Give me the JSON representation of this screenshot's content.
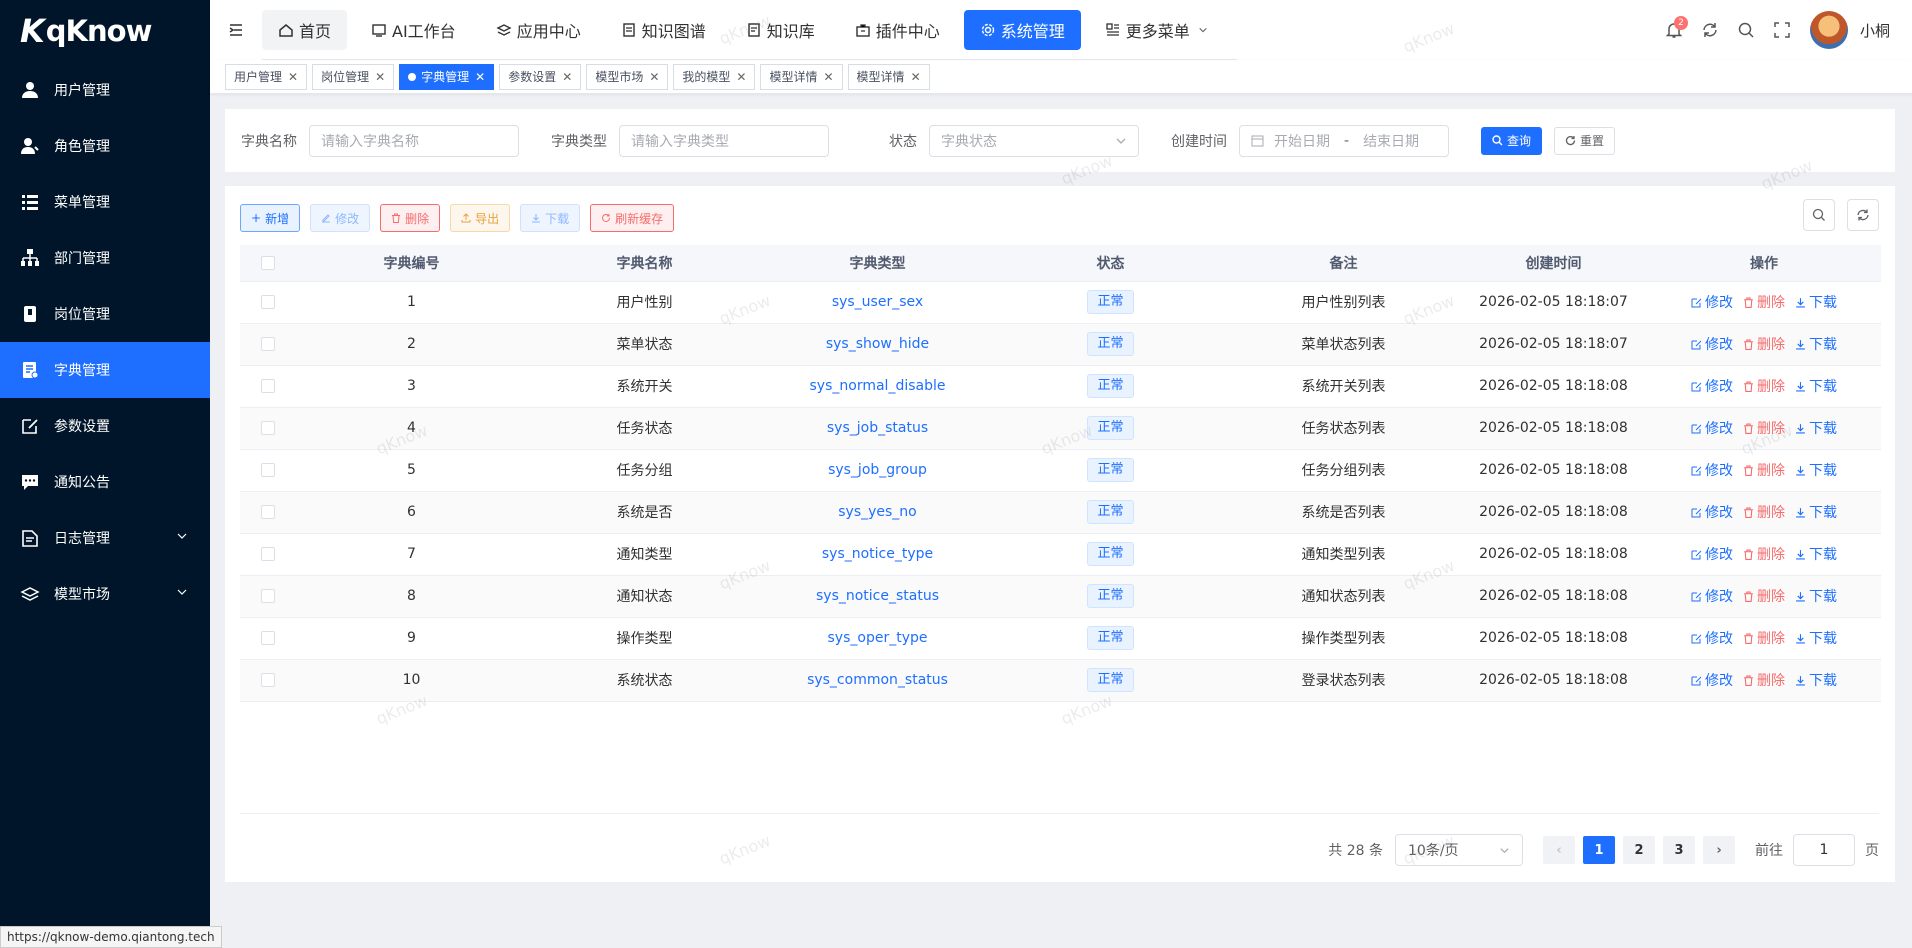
{
  "app": {
    "logo_text": "qKnow",
    "logo_mark": "K"
  },
  "sidebar": {
    "items": [
      {
        "label": "用户管理",
        "icon": "user-icon",
        "active": false
      },
      {
        "label": "角色管理",
        "icon": "role-icon",
        "active": false
      },
      {
        "label": "菜单管理",
        "icon": "menu-icon",
        "active": false
      },
      {
        "label": "部门管理",
        "icon": "org-tree-icon",
        "active": false
      },
      {
        "label": "岗位管理",
        "icon": "badge-icon",
        "active": false
      },
      {
        "label": "字典管理",
        "icon": "dict-icon",
        "active": true
      },
      {
        "label": "参数设置",
        "icon": "edit-icon",
        "active": false
      },
      {
        "label": "通知公告",
        "icon": "message-icon",
        "active": false
      },
      {
        "label": "日志管理",
        "icon": "log-icon",
        "active": false,
        "expandable": true
      },
      {
        "label": "模型市场",
        "icon": "stack-icon",
        "active": false,
        "expandable": true
      }
    ]
  },
  "topnav": {
    "items": [
      {
        "label": "首页",
        "icon": "home-icon"
      },
      {
        "label": "AI工作台",
        "icon": "ai-icon"
      },
      {
        "label": "应用中心",
        "icon": "app-icon"
      },
      {
        "label": "知识图谱",
        "icon": "graph-icon"
      },
      {
        "label": "知识库",
        "icon": "book-icon"
      },
      {
        "label": "插件中心",
        "icon": "plugin-icon"
      },
      {
        "label": "系统管理",
        "icon": "gear-icon"
      },
      {
        "label": "更多菜单",
        "icon": "more-icon"
      }
    ],
    "notification_count": "2",
    "username": "小桐"
  },
  "tags": [
    {
      "label": "用户管理",
      "active": false
    },
    {
      "label": "岗位管理",
      "active": false
    },
    {
      "label": "字典管理",
      "active": true
    },
    {
      "label": "参数设置",
      "active": false
    },
    {
      "label": "模型市场",
      "active": false
    },
    {
      "label": "我的模型",
      "active": false
    },
    {
      "label": "模型详情",
      "active": false
    },
    {
      "label": "模型详情",
      "active": false
    }
  ],
  "search": {
    "name_label": "字典名称",
    "name_placeholder": "请输入字典名称",
    "type_label": "字典类型",
    "type_placeholder": "请输入字典类型",
    "status_label": "状态",
    "status_placeholder": "字典状态",
    "time_label": "创建时间",
    "start_placeholder": "开始日期",
    "range_sep": "-",
    "end_placeholder": "结束日期",
    "query_label": "查询",
    "reset_label": "重置"
  },
  "toolbar": {
    "add_label": "新增",
    "edit_label": "修改",
    "delete_label": "删除",
    "export_label": "导出",
    "download_label": "下载",
    "refresh_cache_label": "刷新缓存"
  },
  "table": {
    "headers": [
      "字典编号",
      "字典名称",
      "字典类型",
      "状态",
      "备注",
      "创建时间",
      "操作"
    ],
    "op_edit": "修改",
    "op_delete": "删除",
    "op_download": "下载",
    "rows": [
      {
        "id": "1",
        "name": "用户性别",
        "type": "sys_user_sex",
        "status": "正常",
        "remark": "用户性别列表",
        "time": "2026-02-05 18:18:07"
      },
      {
        "id": "2",
        "name": "菜单状态",
        "type": "sys_show_hide",
        "status": "正常",
        "remark": "菜单状态列表",
        "time": "2026-02-05 18:18:07"
      },
      {
        "id": "3",
        "name": "系统开关",
        "type": "sys_normal_disable",
        "status": "正常",
        "remark": "系统开关列表",
        "time": "2026-02-05 18:18:08"
      },
      {
        "id": "4",
        "name": "任务状态",
        "type": "sys_job_status",
        "status": "正常",
        "remark": "任务状态列表",
        "time": "2026-02-05 18:18:08"
      },
      {
        "id": "5",
        "name": "任务分组",
        "type": "sys_job_group",
        "status": "正常",
        "remark": "任务分组列表",
        "time": "2026-02-05 18:18:08"
      },
      {
        "id": "6",
        "name": "系统是否",
        "type": "sys_yes_no",
        "status": "正常",
        "remark": "系统是否列表",
        "time": "2026-02-05 18:18:08"
      },
      {
        "id": "7",
        "name": "通知类型",
        "type": "sys_notice_type",
        "status": "正常",
        "remark": "通知类型列表",
        "time": "2026-02-05 18:18:08"
      },
      {
        "id": "8",
        "name": "通知状态",
        "type": "sys_notice_status",
        "status": "正常",
        "remark": "通知状态列表",
        "time": "2026-02-05 18:18:08"
      },
      {
        "id": "9",
        "name": "操作类型",
        "type": "sys_oper_type",
        "status": "正常",
        "remark": "操作类型列表",
        "time": "2026-02-05 18:18:08"
      },
      {
        "id": "10",
        "name": "系统状态",
        "type": "sys_common_status",
        "status": "正常",
        "remark": "登录状态列表",
        "time": "2026-02-05 18:18:08"
      }
    ]
  },
  "pagination": {
    "total_text": "共 28 条",
    "page_size": "10条/页",
    "pages": [
      "1",
      "2",
      "3"
    ],
    "current": "1",
    "goto_label": "前往",
    "goto_value": "1",
    "page_suffix": "页"
  },
  "watermark": "qKnow",
  "status_url": "https://qknow-demo.qiantong.tech",
  "colors": {
    "primary": "#1e6fff",
    "sidebar": "#001529",
    "danger": "#f56c6c",
    "warning": "#e6a23c"
  }
}
